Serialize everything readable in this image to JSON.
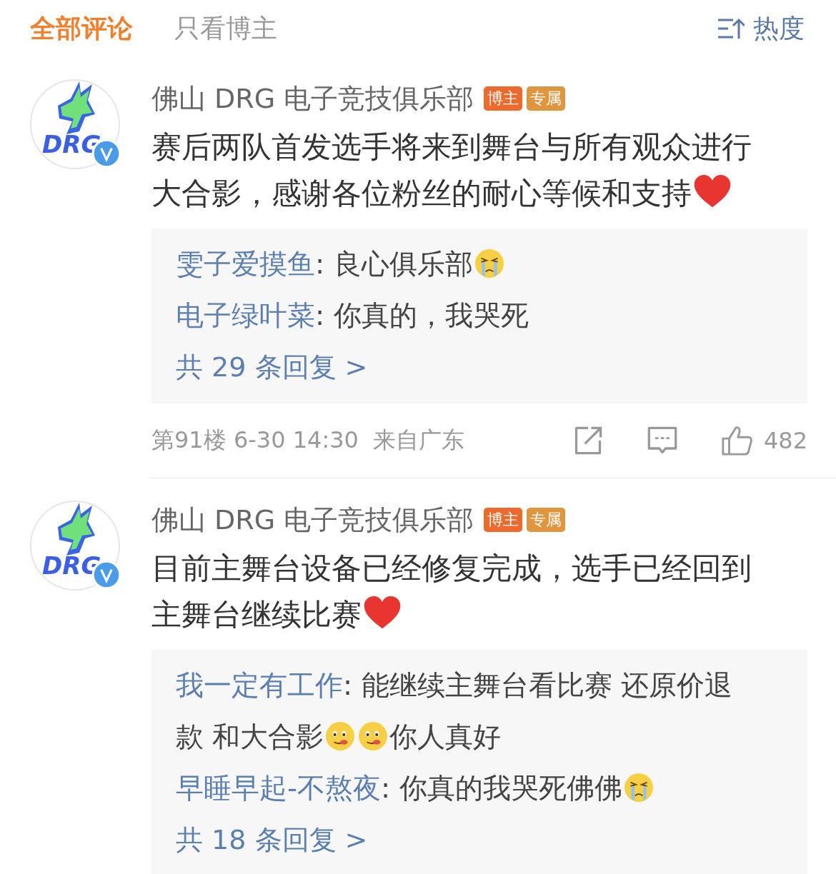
{
  "tabs": [
    {
      "label": "全部评论",
      "selected": true
    },
    {
      "label": "只看博主",
      "selected": false
    }
  ],
  "sort": {
    "label": "热度"
  },
  "comments": [
    {
      "author": "佛山 DRG 电子竞技俱乐部",
      "logo_text": "DRG",
      "verified": true,
      "badges": [
        {
          "label": "博主",
          "color": "#ee6a2c"
        },
        {
          "label": "专属",
          "color": "#e0953f"
        }
      ],
      "body": [
        {
          "kind": "text",
          "text": "赛后两队首发选手将来到舞台与所有观众进行"
        },
        {
          "kind": "text",
          "text": "大合影，感谢各位粉丝的耐心等候和支持"
        },
        {
          "kind": "heart"
        }
      ],
      "replies": [
        {
          "author": "雯子爱摸鱼",
          "parts": [
            {
              "kind": "text",
              "text": ": 良心俱乐部"
            },
            {
              "kind": "crying"
            }
          ]
        },
        {
          "author": "电子绿叶菜",
          "parts": [
            {
              "kind": "text",
              "text": ": 你真的，我哭死"
            }
          ]
        }
      ],
      "more": "共 29 条回复 >",
      "meta": "第91楼 6-30 14:30  来自广东",
      "likes": "482"
    },
    {
      "author": "佛山 DRG 电子竞技俱乐部",
      "logo_text": "DRG",
      "verified": true,
      "badges": [
        {
          "label": "博主",
          "color": "#ee6a2c"
        },
        {
          "label": "专属",
          "color": "#e0953f"
        }
      ],
      "body": [
        {
          "kind": "text",
          "text": "目前主舞台设备已经修复完成，选手已经回到"
        },
        {
          "kind": "text",
          "text": "主舞台继续比赛"
        },
        {
          "kind": "heart"
        }
      ],
      "replies": [
        {
          "author": "我一定有工作",
          "parts": [
            {
              "kind": "text",
              "text": ": 能继续主舞台看比赛 还原价退"
            },
            {
              "kind": "text",
              "text": "款 和大合影"
            },
            {
              "kind": "tongue"
            },
            {
              "kind": "tongue"
            },
            {
              "kind": "text",
              "text": "你人真好"
            }
          ]
        },
        {
          "author": "早睡早起-不熬夜",
          "parts": [
            {
              "kind": "text",
              "text": ": 你真的我哭死佛佛"
            },
            {
              "kind": "crying"
            }
          ]
        }
      ],
      "more": "共 18 条回复 >"
    }
  ]
}
